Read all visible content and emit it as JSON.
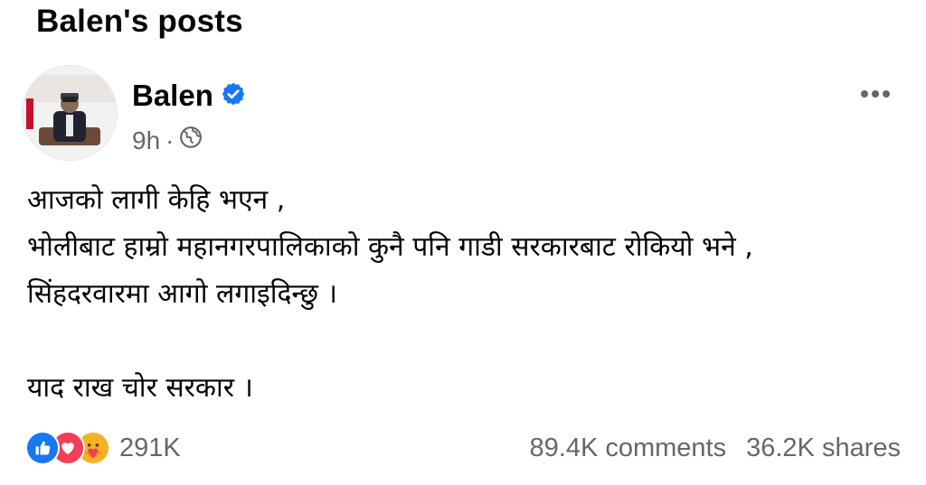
{
  "header": {
    "title": "Balen's posts"
  },
  "post": {
    "author": {
      "name": "Balen",
      "verified_icon": "verified-badge-icon"
    },
    "meta": {
      "time": "9h",
      "separator": "·",
      "audience_icon": "globe-icon"
    },
    "body_lines": [
      "आजको लागी केहि भएन ,",
      "भोलीबाट हाम्रो महानगरपालिकाको कुनै पनि गाडी सरकारबाट रोकियो भने ,",
      "सिंहदरवारमा आगो लगाइदिन्छु ।",
      "",
      "याद राख चोर सरकार ।"
    ],
    "reactions": {
      "icons": [
        "like-icon",
        "love-icon",
        "care-icon"
      ],
      "count": "291K"
    },
    "stats": {
      "comments": "89.4K comments",
      "shares": "36.2K shares"
    }
  },
  "colors": {
    "like": "#1877f2",
    "love": "#f33e58",
    "care": "#f7b125",
    "verified": "#1877f2",
    "muted_text": "#65676b"
  }
}
